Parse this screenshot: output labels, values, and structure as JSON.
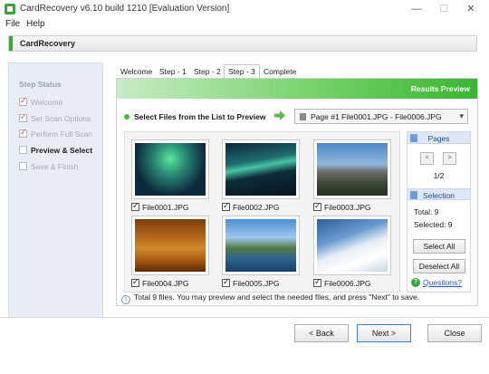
{
  "window": {
    "title": "CardRecovery v6.10 build 1210 [Evaluation Version]",
    "min": "—",
    "max": "☐",
    "close": "✕"
  },
  "menu": [
    "File",
    "Help"
  ],
  "header": {
    "title": "CardRecovery"
  },
  "sidebar": {
    "title": "Step Status",
    "steps": [
      {
        "label": "Welcome",
        "state": "done"
      },
      {
        "label": "Set Scan Options",
        "state": "done"
      },
      {
        "label": "Perform Full Scan",
        "state": "done"
      },
      {
        "label": "Preview & Select",
        "state": "current"
      },
      {
        "label": "Save & Finish",
        "state": "pending"
      }
    ]
  },
  "tabs": [
    "Welcome",
    "Step - 1",
    "Step - 2",
    "Step - 3",
    "Complete"
  ],
  "active_tab": "Step - 3",
  "panel": {
    "banner": "Results Preview",
    "instruction": "Select Files from the List to Preview",
    "page_select": "Page #1   File0001.JPG - File0006.JPG",
    "files": [
      {
        "name": "File0001.JPG",
        "checked": true,
        "image": "aurora"
      },
      {
        "name": "File0002.JPG",
        "checked": true,
        "image": "aurora-lake"
      },
      {
        "name": "File0003.JPG",
        "checked": true,
        "image": "mountain-town"
      },
      {
        "name": "File0004.JPG",
        "checked": true,
        "image": "orange-reeds"
      },
      {
        "name": "File0005.JPG",
        "checked": true,
        "image": "mountain-lake"
      },
      {
        "name": "File0006.JPG",
        "checked": true,
        "image": "snowboarder"
      }
    ]
  },
  "right_panel": {
    "pages_title": "Pages",
    "prev": "<",
    "next": ">",
    "page_count": "1/2",
    "selection_title": "Selection",
    "total": "Total:  9",
    "selected": "Selected:  9",
    "select_all": "Select All",
    "deselect_all": "Deselect All",
    "questions": "Questions?"
  },
  "footer_note": "Total 9 files.  You may preview and select the needed files, and press \"Next\" to save.",
  "buttons": {
    "back": "< Back",
    "next": "Next >",
    "close": "Close"
  }
}
